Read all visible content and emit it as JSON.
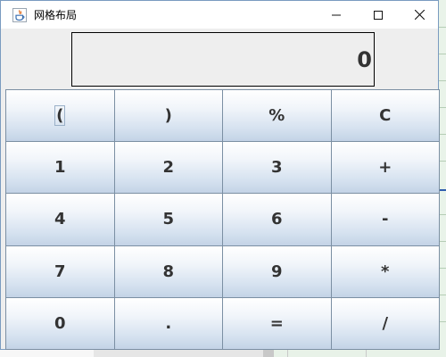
{
  "window": {
    "title": "网格布局",
    "icons": {
      "app": "java-icon",
      "minimize": "minimize-icon",
      "maximize": "maximize-icon",
      "close": "close-icon"
    }
  },
  "display": {
    "value": "0"
  },
  "keypad": {
    "rows": [
      [
        "(",
        ")",
        "%",
        "C"
      ],
      [
        "1",
        "2",
        "3",
        "+"
      ],
      [
        "4",
        "5",
        "6",
        "-"
      ],
      [
        "7",
        "8",
        "9",
        "*"
      ],
      [
        "0",
        ".",
        "=",
        "/"
      ]
    ]
  },
  "colors": {
    "window_border": "#7a9bc0",
    "button_top": "#ffffff",
    "button_bottom": "#c3d3e6",
    "button_border": "#7b8fa3",
    "content_bg": "#eeeeee"
  }
}
